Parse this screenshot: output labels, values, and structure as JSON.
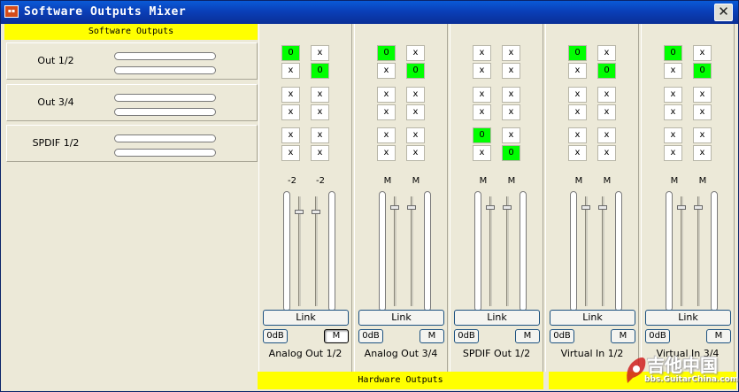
{
  "window": {
    "title": "Software Outputs Mixer",
    "close_symbol": "✕",
    "icon": "app-icon"
  },
  "software_outputs": {
    "header": "Software Outputs",
    "rows": [
      {
        "label": "Out 1/2"
      },
      {
        "label": "Out 3/4"
      },
      {
        "label": "SPDIF 1/2"
      }
    ]
  },
  "hardware_outputs_label": "Hardware Outputs",
  "strips": [
    {
      "name": "Analog Out 1/2",
      "matrix": [
        [
          "0",
          "x"
        ],
        [
          "x",
          "0"
        ],
        [
          "x",
          "x"
        ],
        [
          "x",
          "x"
        ],
        [
          "x",
          "x"
        ],
        [
          "x",
          "x"
        ]
      ],
      "active": [
        [
          true,
          false
        ],
        [
          false,
          true
        ],
        [
          false,
          false
        ],
        [
          false,
          false
        ],
        [
          false,
          false
        ],
        [
          false,
          false
        ]
      ],
      "fader_labels": [
        "-2",
        "-2"
      ],
      "link": "Link",
      "db": "0dB",
      "mute": "M",
      "mute_pressed": true
    },
    {
      "name": "Analog Out 3/4",
      "matrix": [
        [
          "0",
          "x"
        ],
        [
          "x",
          "0"
        ],
        [
          "x",
          "x"
        ],
        [
          "x",
          "x"
        ],
        [
          "x",
          "x"
        ],
        [
          "x",
          "x"
        ]
      ],
      "active": [
        [
          true,
          false
        ],
        [
          false,
          true
        ],
        [
          false,
          false
        ],
        [
          false,
          false
        ],
        [
          false,
          false
        ],
        [
          false,
          false
        ]
      ],
      "fader_labels": [
        "M",
        "M"
      ],
      "link": "Link",
      "db": "0dB",
      "mute": "M",
      "mute_pressed": false
    },
    {
      "name": "SPDIF Out 1/2",
      "matrix": [
        [
          "x",
          "x"
        ],
        [
          "x",
          "x"
        ],
        [
          "x",
          "x"
        ],
        [
          "x",
          "x"
        ],
        [
          "0",
          "x"
        ],
        [
          "x",
          "0"
        ]
      ],
      "active": [
        [
          false,
          false
        ],
        [
          false,
          false
        ],
        [
          false,
          false
        ],
        [
          false,
          false
        ],
        [
          true,
          false
        ],
        [
          false,
          true
        ]
      ],
      "fader_labels": [
        "M",
        "M"
      ],
      "link": "Link",
      "db": "0dB",
      "mute": "M",
      "mute_pressed": false
    },
    {
      "name": "Virtual In 1/2",
      "matrix": [
        [
          "0",
          "x"
        ],
        [
          "x",
          "0"
        ],
        [
          "x",
          "x"
        ],
        [
          "x",
          "x"
        ],
        [
          "x",
          "x"
        ],
        [
          "x",
          "x"
        ]
      ],
      "active": [
        [
          true,
          false
        ],
        [
          false,
          true
        ],
        [
          false,
          false
        ],
        [
          false,
          false
        ],
        [
          false,
          false
        ],
        [
          false,
          false
        ]
      ],
      "fader_labels": [
        "M",
        "M"
      ],
      "link": "Link",
      "db": "0dB",
      "mute": "M",
      "mute_pressed": false
    },
    {
      "name": "Virtual In 3/4",
      "matrix": [
        [
          "0",
          "x"
        ],
        [
          "x",
          "0"
        ],
        [
          "x",
          "x"
        ],
        [
          "x",
          "x"
        ],
        [
          "x",
          "x"
        ],
        [
          "x",
          "x"
        ]
      ],
      "active": [
        [
          true,
          false
        ],
        [
          false,
          true
        ],
        [
          false,
          false
        ],
        [
          false,
          false
        ],
        [
          false,
          false
        ],
        [
          false,
          false
        ]
      ],
      "fader_labels": [
        "M",
        "M"
      ],
      "link": "Link",
      "db": "0dB",
      "mute": "M",
      "mute_pressed": false
    }
  ],
  "watermark": {
    "line1": "吉他中国",
    "line2": "bbs.GuitarChina.com"
  }
}
